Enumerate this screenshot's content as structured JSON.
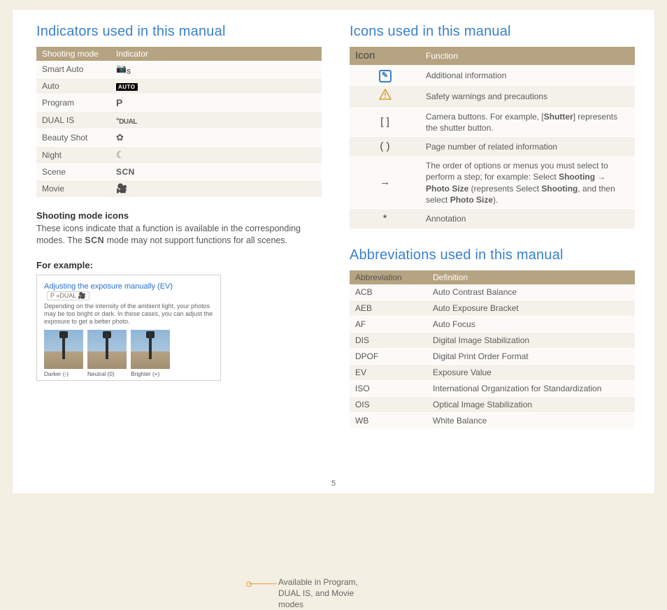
{
  "pageNumber": "5",
  "left": {
    "heading": "Indicators used in this manual",
    "tableHeaders": {
      "c1": "Shooting mode",
      "c2": "Indicator"
    },
    "rows": [
      {
        "mode": "Smart Auto",
        "ind": "smart"
      },
      {
        "mode": "Auto",
        "ind": "auto"
      },
      {
        "mode": "Program",
        "ind": "P"
      },
      {
        "mode": "DUAL IS",
        "ind": "dual"
      },
      {
        "mode": "Beauty Shot",
        "ind": "beauty"
      },
      {
        "mode": "Night",
        "ind": "night"
      },
      {
        "mode": "Scene",
        "ind": "SCN"
      },
      {
        "mode": "Movie",
        "ind": "movie"
      }
    ],
    "subhead": "Shooting mode icons",
    "para_a": "These icons indicate that a function is available in the corresponding modes. The ",
    "para_scn": "SCN",
    "para_b": " mode may not support functions for all scenes.",
    "forExample": "For example:",
    "example": {
      "title": "Adjusting the exposure manually (EV)",
      "modeIcons": "P  «DUAL  🎥",
      "body": "Depending on the intensity of the ambient light, your photos may be too bright or dark. In these cases, you can adjust the exposure to get a better photo.",
      "thumbs": [
        {
          "label": "Darker (-)"
        },
        {
          "label": "Neutral (0)"
        },
        {
          "label": "Brighter (+)"
        }
      ]
    },
    "sideNote": "Available in Program, DUAL IS, and Movie modes"
  },
  "right": {
    "iconsHeading": "Icons used in this manual",
    "iconsHeaders": {
      "c1": "Icon",
      "c2": "Function"
    },
    "iconsRows": [
      {
        "icon": "info",
        "text": "Additional information"
      },
      {
        "icon": "warn",
        "text": "Safety warnings and precautions"
      },
      {
        "icon": "[  ]",
        "text_a": "Camera buttons. For example, [",
        "bold": "Shutter",
        "text_b": "] represents the shutter button."
      },
      {
        "icon": "(  )",
        "text": "Page number of related information"
      },
      {
        "icon": "→",
        "text_a": "The order of options or menus you must select to perform a step; for example: Select ",
        "b1": "Shooting",
        "arrow": " → ",
        "b2": "Photo Size",
        "text_b": " (represents Select ",
        "b3": "Shooting",
        "text_c": ", and then select ",
        "b4": "Photo Size",
        "text_d": ")."
      },
      {
        "icon": "*",
        "text": "Annotation"
      }
    ],
    "abbrHeading": "Abbreviations used in this manual",
    "abbrHeaders": {
      "c1": "Abbreviation",
      "c2": "Definition"
    },
    "abbrRows": [
      {
        "a": "ACB",
        "d": "Auto Contrast Balance"
      },
      {
        "a": "AEB",
        "d": "Auto Exposure Bracket"
      },
      {
        "a": "AF",
        "d": "Auto Focus"
      },
      {
        "a": "DIS",
        "d": "Digital Image Stabilization"
      },
      {
        "a": "DPOF",
        "d": "Digital Print Order Format"
      },
      {
        "a": "EV",
        "d": "Exposure Value"
      },
      {
        "a": "ISO",
        "d": "International Organization for Standardization"
      },
      {
        "a": "OIS",
        "d": "Optical Image Stabilization"
      },
      {
        "a": "WB",
        "d": "White Balance"
      }
    ]
  }
}
